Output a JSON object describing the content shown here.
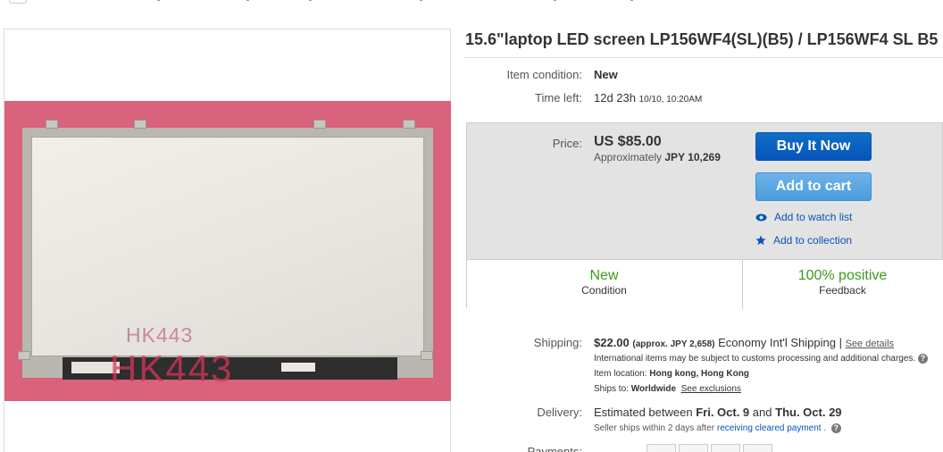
{
  "title": "15.6\"laptop LED screen LP156WF4(SL)(B5) / LP156WF4 SL B5",
  "item_condition": {
    "label": "Item condition:",
    "value": "New"
  },
  "time_left": {
    "label": "Time left:",
    "value": "12d 23h",
    "detail": "10/10, 10:20AM"
  },
  "price": {
    "label": "Price:",
    "value": "US $85.00",
    "approx_prefix": "Approximately",
    "approx_value": "JPY 10,269"
  },
  "actions": {
    "buy_now": "Buy It Now",
    "add_to_cart": "Add to cart",
    "watch": "Add to watch list",
    "collection": "Add to collection"
  },
  "summary": {
    "condition_value": "New",
    "condition_label": "Condition",
    "feedback_value": "100% positive",
    "feedback_label": "Feedback"
  },
  "shipping": {
    "label": "Shipping:",
    "cost": "$22.00",
    "approx": "(approx. JPY 2,658)",
    "service": "Economy Int'l Shipping",
    "separator": "|",
    "details_link": "See details",
    "note": "International items may be subject to customs processing and additional charges.",
    "location_label": "Item location:",
    "location": "Hong kong, Hong Kong",
    "ships_to_label": "Ships to:",
    "ships_to": "Worldwide",
    "exclusions_link": "See exclusions"
  },
  "delivery": {
    "label": "Delivery:",
    "prefix": "Estimated between",
    "start": "Fri. Oct. 9",
    "and": "and",
    "end": "Thu. Oct. 29",
    "note_prefix": "Seller ships within 2 days after",
    "note_link": "receiving cleared payment",
    "note_suffix": "."
  },
  "payments": {
    "label": "Payments:"
  },
  "image": {
    "watermark": "HK443"
  },
  "colors": {
    "buy": "#0654ba",
    "cart": "#4a9cdc",
    "green": "#3a9a1c",
    "link": "#0654ba"
  },
  "icons": [
    "eye-icon",
    "star-icon",
    "help-icon"
  ]
}
